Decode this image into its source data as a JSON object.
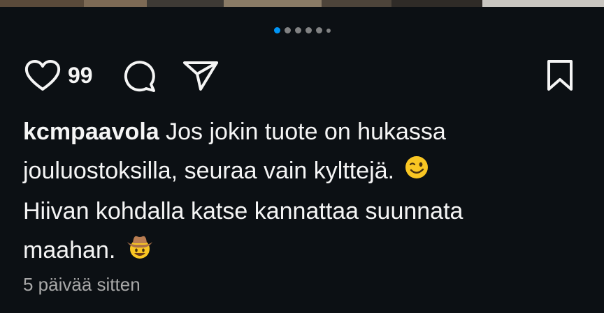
{
  "carousel": {
    "dot_count": 6,
    "active_index": 0
  },
  "actions": {
    "like_icon": "heart-icon",
    "like_count": "99",
    "comment_icon": "comment-icon",
    "share_icon": "send-icon",
    "save_icon": "bookmark-icon"
  },
  "caption": {
    "username": "kcmpaavola",
    "line1_text": "Jos jokin tuote on hukassa",
    "line2_text": "jouluostoksilla, seuraa vain kylttejä.",
    "line2_emoji": "winking-face-emoji",
    "line3_text": "Hiivan kohdalla katse kannattaa suunnata",
    "line4_text": "maahan.",
    "line4_emoji": "cowboy-hat-face-emoji"
  },
  "meta": {
    "timestamp": "5 päivää sitten"
  },
  "colors": {
    "background": "#0c1014",
    "text": "#f5f5f5",
    "muted": "#a8a8a8",
    "accent": "#0095f6"
  }
}
